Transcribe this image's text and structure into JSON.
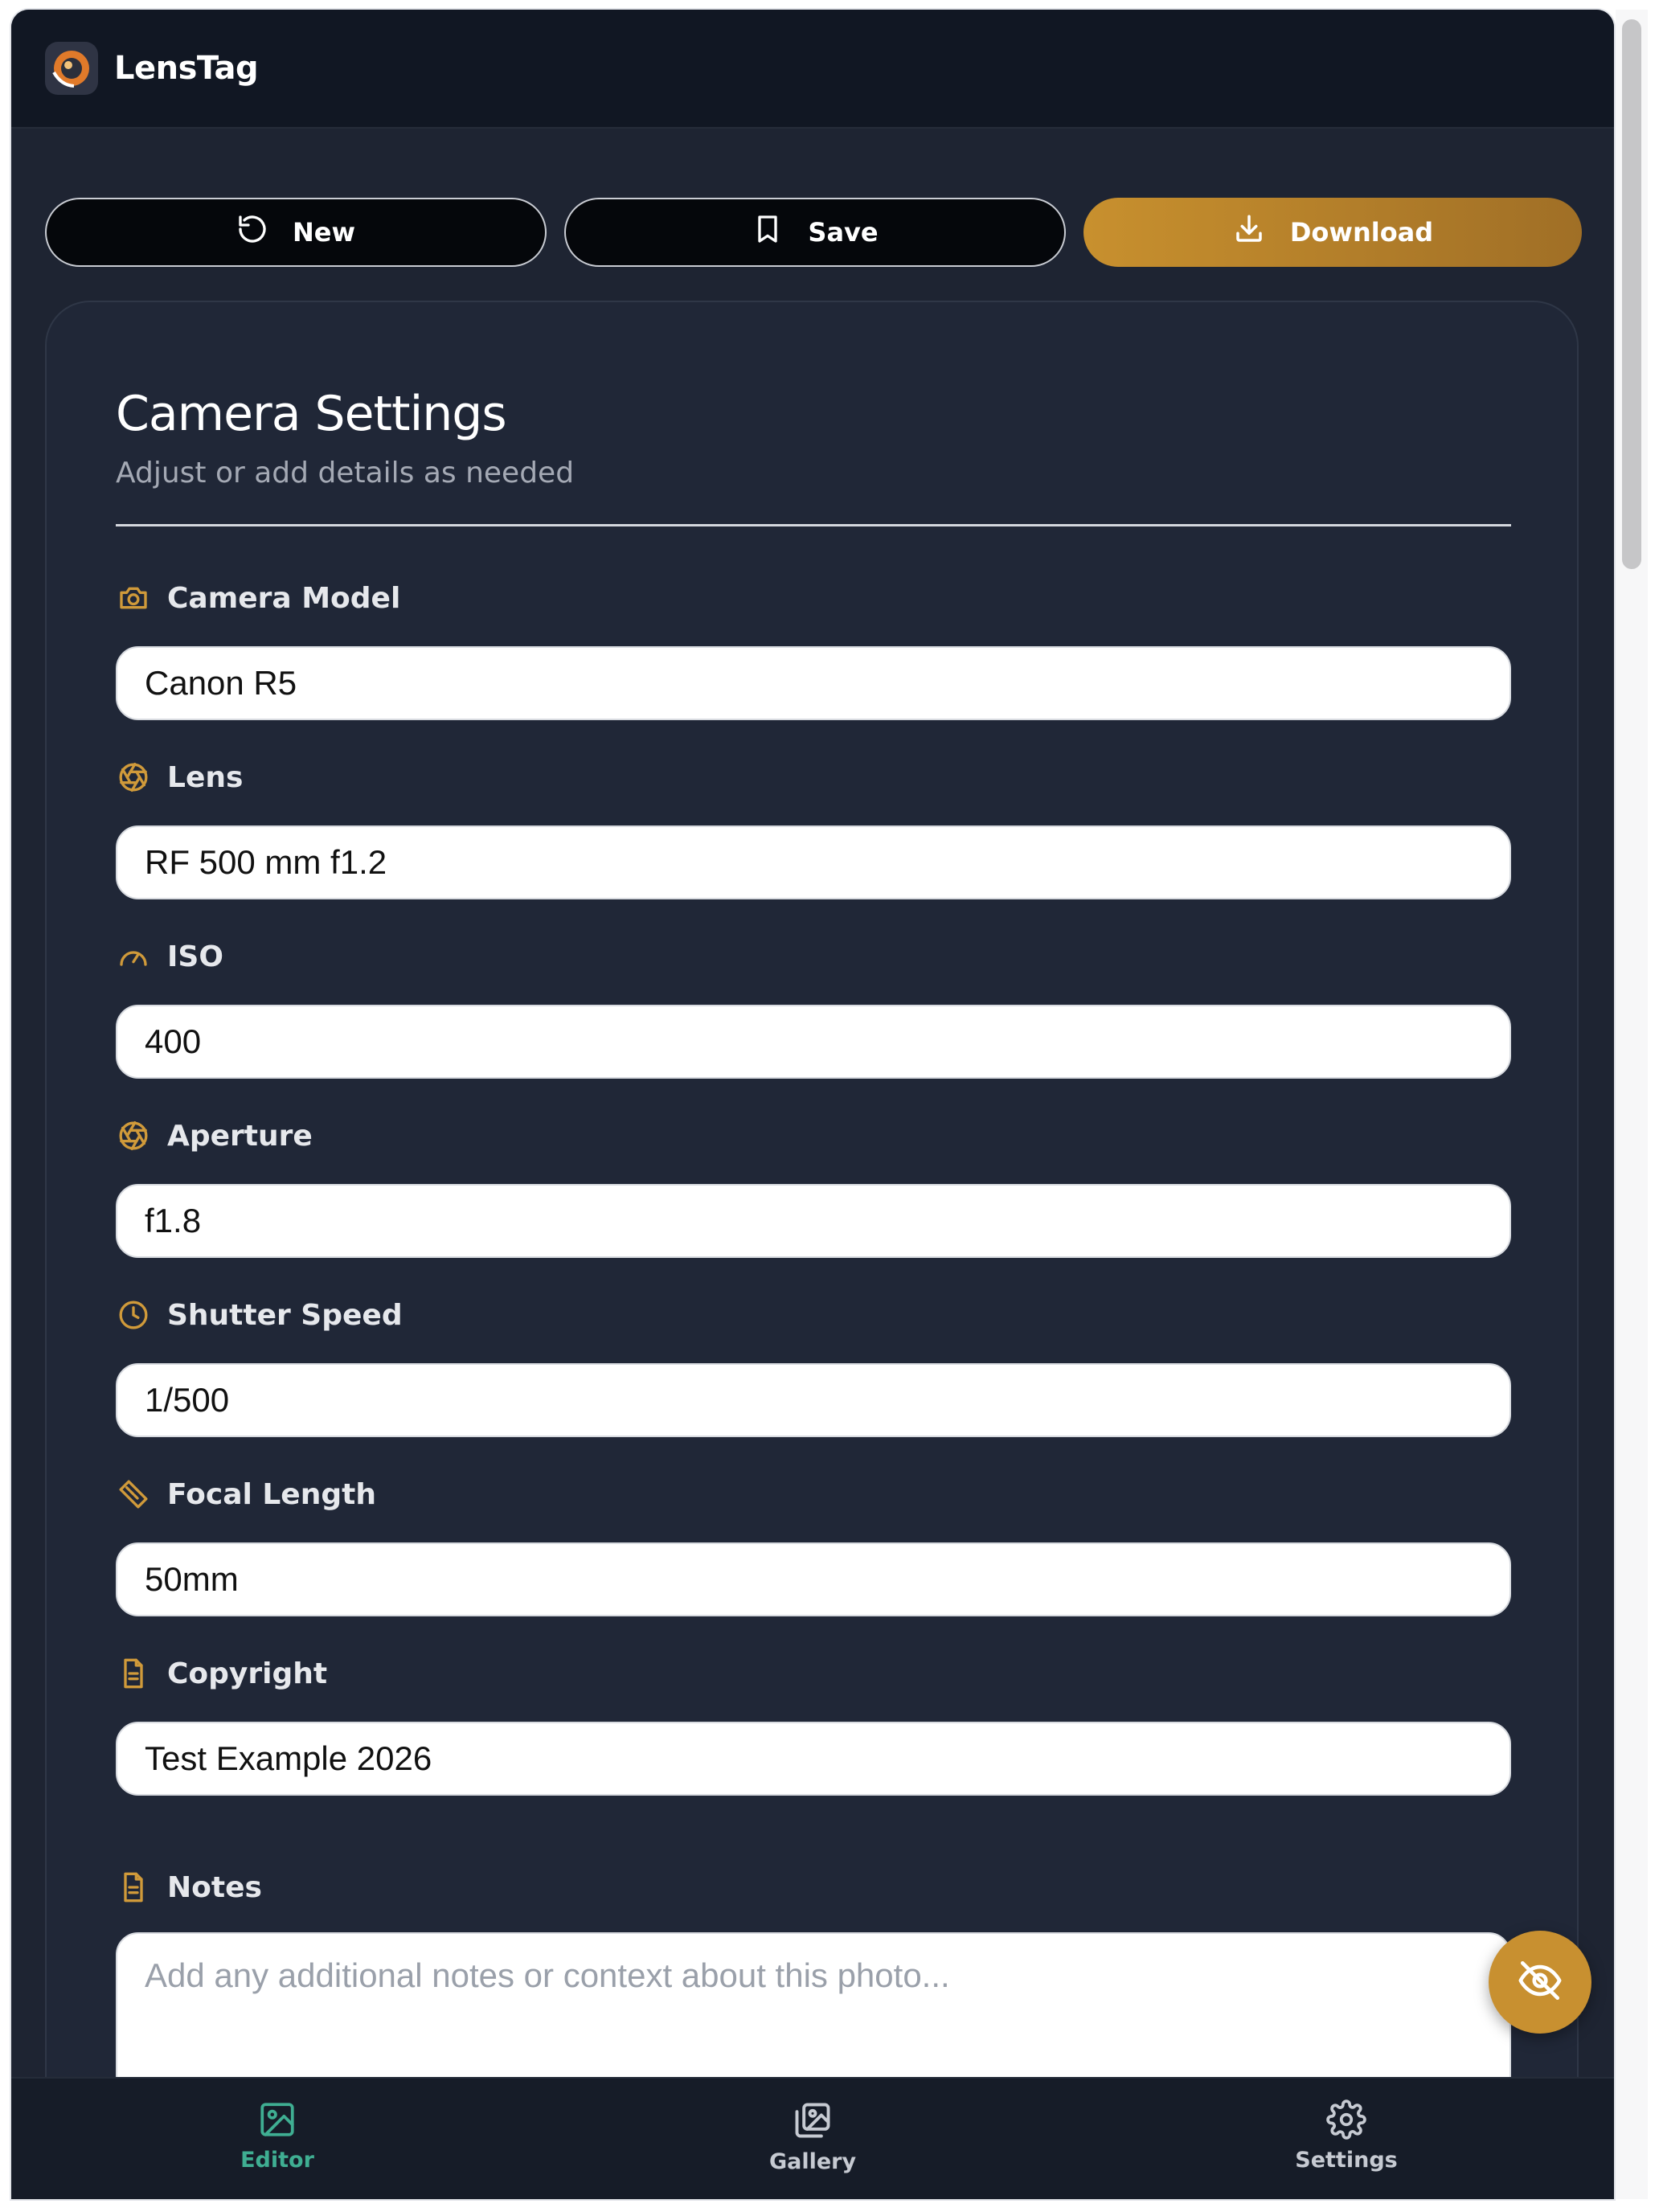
{
  "app": {
    "title": "LensTag"
  },
  "toolbar": {
    "new_label": "New",
    "save_label": "Save",
    "download_label": "Download"
  },
  "card": {
    "title": "Camera Settings",
    "subtitle": "Adjust or add details as needed"
  },
  "fields": [
    {
      "label": "Camera Model",
      "value": "Canon R5",
      "icon": "camera-icon"
    },
    {
      "label": "Lens",
      "value": "RF 500 mm f1.2",
      "icon": "aperture-icon"
    },
    {
      "label": "ISO",
      "value": "400",
      "icon": "gauge-icon"
    },
    {
      "label": "Aperture",
      "value": "f1.8",
      "icon": "aperture-icon"
    },
    {
      "label": "Shutter Speed",
      "value": "1/500",
      "icon": "clock-icon"
    },
    {
      "label": "Focal Length",
      "value": "50mm",
      "icon": "ruler-icon"
    },
    {
      "label": "Copyright",
      "value": "Test Example 2026",
      "icon": "document-icon"
    }
  ],
  "notes": {
    "label": "Notes",
    "placeholder": "Add any additional notes or context about this photo...",
    "icon": "document-icon"
  },
  "bottom_nav": {
    "items": [
      {
        "label": "Editor",
        "icon": "image-icon",
        "active": true
      },
      {
        "label": "Gallery",
        "icon": "gallery-icon",
        "active": false
      },
      {
        "label": "Settings",
        "icon": "gear-icon",
        "active": false
      }
    ]
  },
  "colors": {
    "accent": "#c8902e",
    "active_nav": "#3fae92",
    "background": "#1e2432"
  }
}
